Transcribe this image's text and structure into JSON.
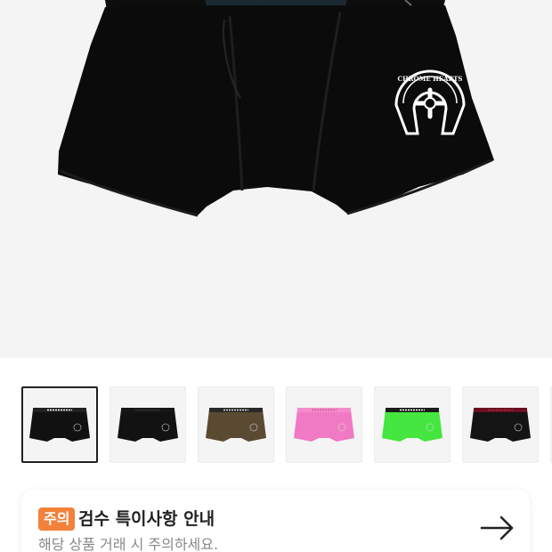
{
  "hero": {
    "product_image": "black-boxer-briefs-chrome-hearts-horseshoe-logo",
    "logo_text": "CHROME HEARTS"
  },
  "thumbnails": [
    {
      "name": "thumb-black-white-band",
      "body": "#111111",
      "band": "#222222",
      "band_text": "#ffffff",
      "selected": true
    },
    {
      "name": "thumb-black",
      "body": "#121212",
      "band": "#161616",
      "band_text": "#3a3a3a",
      "selected": false
    },
    {
      "name": "thumb-camo",
      "body": "#5b4a32",
      "band": "#2a2a2a",
      "band_text": "#d8d8d8",
      "selected": false
    },
    {
      "name": "thumb-pink",
      "body": "#f07ac3",
      "band": "#f48ccb",
      "band_text": "#d05aa0",
      "selected": false
    },
    {
      "name": "thumb-green",
      "body": "#44e63f",
      "band": "#1c1c1c",
      "band_text": "#ffffff",
      "selected": false
    },
    {
      "name": "thumb-black-red-band",
      "body": "#141414",
      "band": "#6b1020",
      "band_text": "#a02a3a",
      "selected": false
    }
  ],
  "notice": {
    "badge": "주의",
    "title": "검수 특이사항 안내",
    "subtitle": "해당 상품 거래 시 주의하세요.",
    "accent": "#f2813a",
    "arrow_icon": "arrow-right-icon"
  }
}
